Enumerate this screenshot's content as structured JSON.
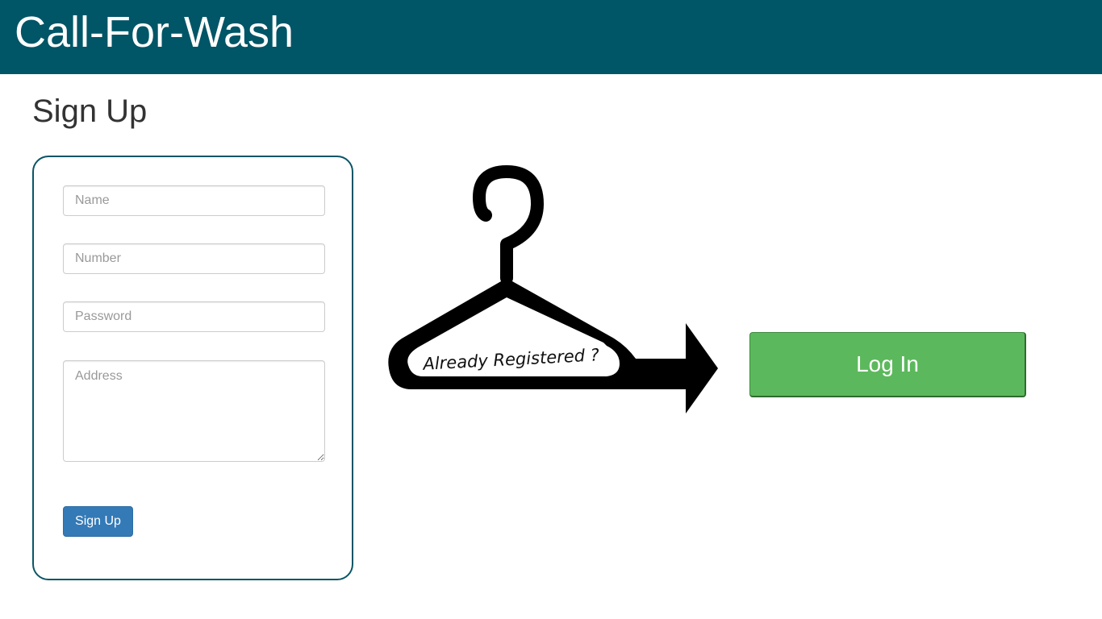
{
  "header": {
    "brand": "Call-For-Wash",
    "background_color": "#005566"
  },
  "page": {
    "title": "Sign Up"
  },
  "signup_form": {
    "name_placeholder": "Name",
    "number_placeholder": "Number",
    "password_placeholder": "Password",
    "address_placeholder": "Address",
    "name_value": "",
    "number_value": "",
    "password_value": "",
    "address_value": "",
    "submit_label": "Sign Up",
    "submit_color": "#337ab7",
    "card_border_color": "#0a5566"
  },
  "login_prompt": {
    "illustration_text": "Already Registered ?",
    "illustration_icon": "clothes-hanger-arrow-icon",
    "login_label": "Log In",
    "login_color": "#5cb85c"
  }
}
